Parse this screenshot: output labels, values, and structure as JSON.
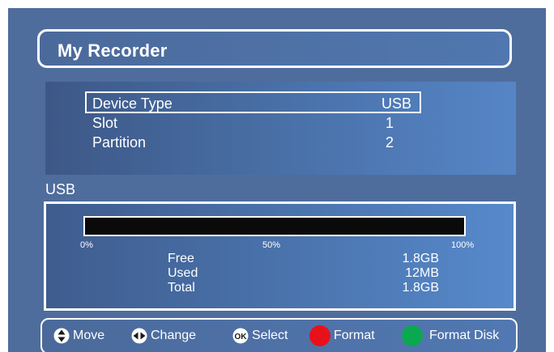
{
  "header": {
    "title": "My Recorder"
  },
  "device": {
    "rows": [
      {
        "label": "Device Type",
        "value": "USB"
      },
      {
        "label": "Slot",
        "value": "1"
      },
      {
        "label": "Partition",
        "value": "2"
      }
    ]
  },
  "usb": {
    "section_label": "USB",
    "usage_fraction": 0.0,
    "ticks": [
      "0%",
      "50%",
      "100%"
    ],
    "stats": [
      {
        "label": "Free",
        "value": "1.8GB"
      },
      {
        "label": "Used",
        "value": "12MB"
      },
      {
        "label": "Total",
        "value": "1.8GB"
      }
    ]
  },
  "help": {
    "move": {
      "icon": "up-down-arrows-icon",
      "label": "Move"
    },
    "change": {
      "icon": "left-right-arrows-icon",
      "label": "Change"
    },
    "select": {
      "icon": "ok-button-icon",
      "icon_text": "OK",
      "label": "Select"
    },
    "format": {
      "icon": "red-button-icon",
      "color": "#e8111b",
      "label": "Format"
    },
    "format_disk": {
      "icon": "green-button-icon",
      "color": "#0aa84f",
      "label": "Format Disk"
    }
  },
  "colors": {
    "background": "#4f6d9c",
    "text": "#ffffff",
    "bar_track": "#0a0a0a"
  }
}
